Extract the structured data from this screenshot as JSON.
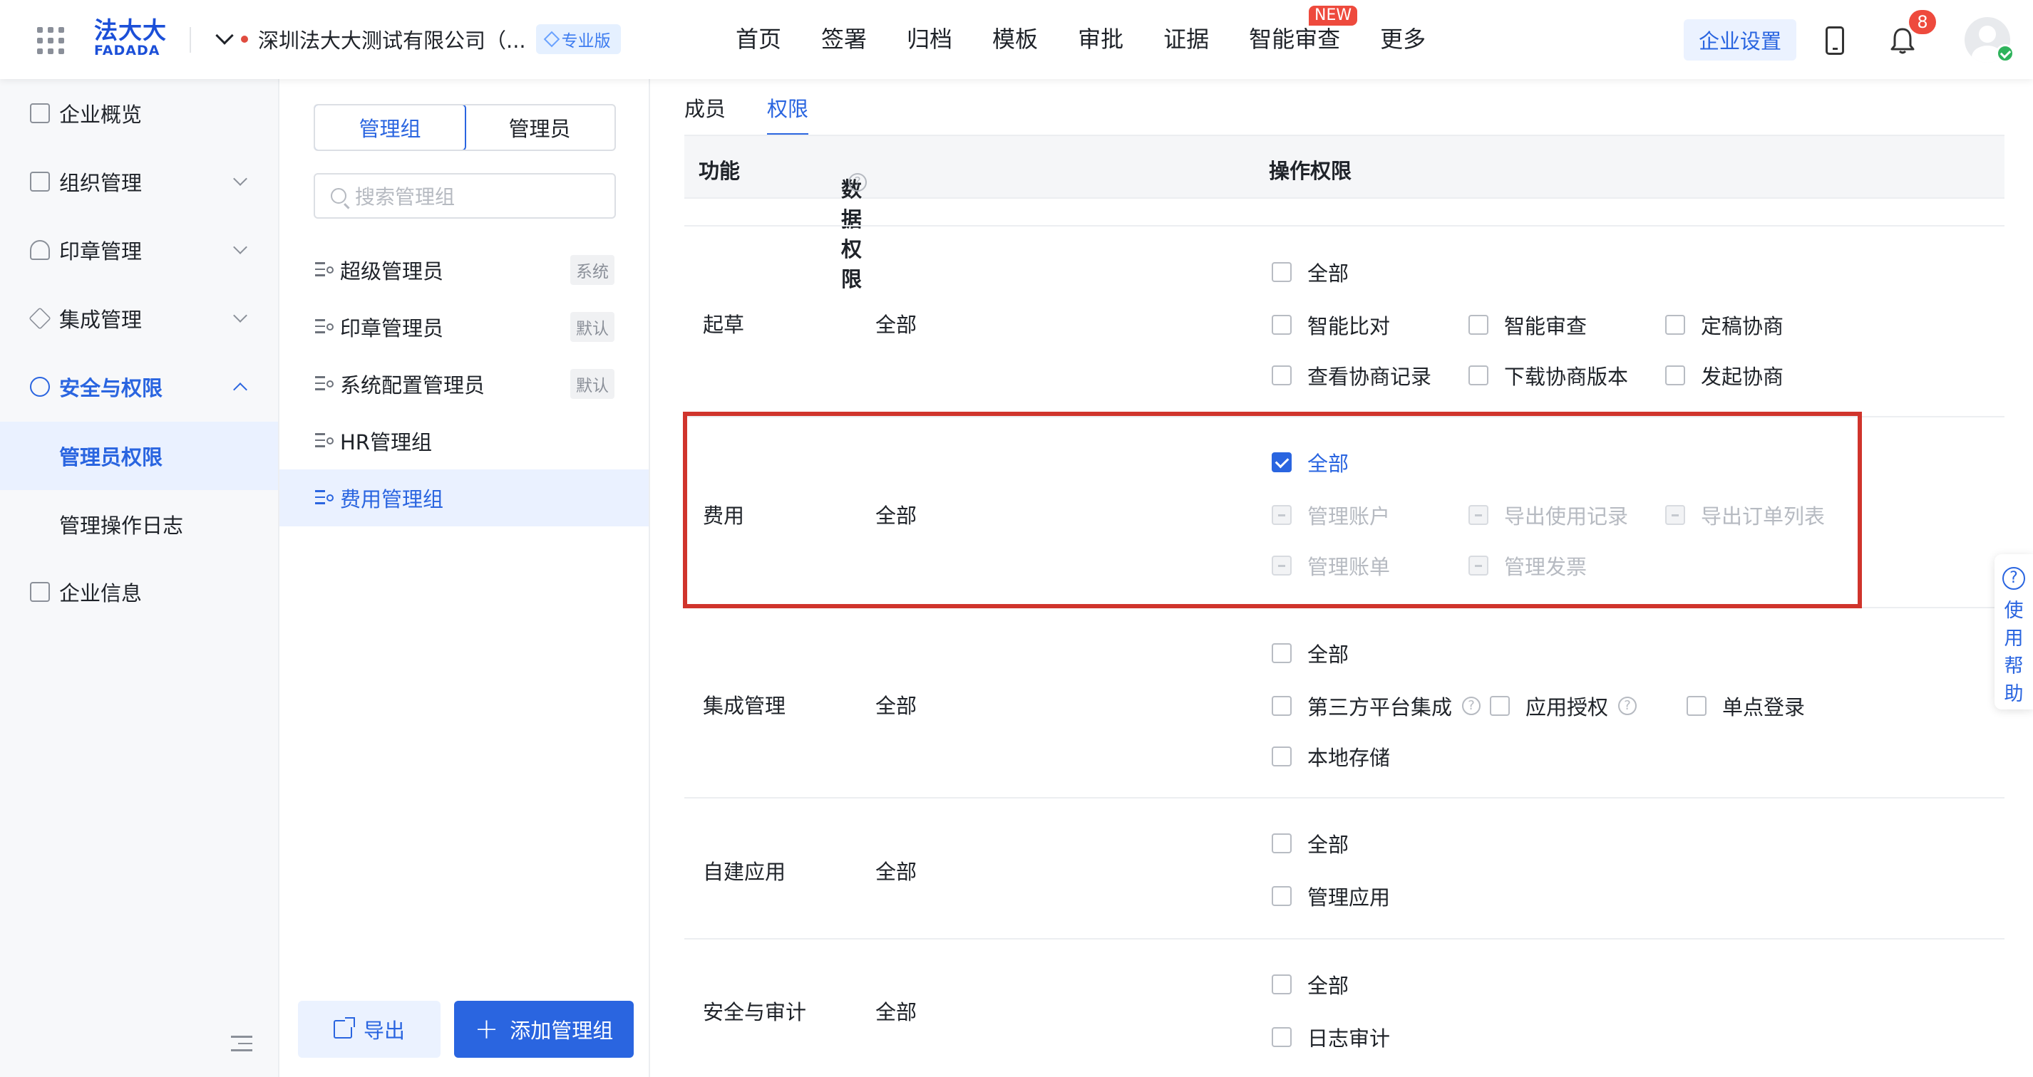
{
  "header": {
    "logo_cn": "法大大",
    "logo_en": "FADADA",
    "company_name": "深圳法大大测试有限公司（...",
    "plan_badge": "专业版",
    "nav": [
      "首页",
      "签署",
      "归档",
      "模板",
      "审批",
      "证据",
      "智能审查",
      "更多"
    ],
    "new_tag": "NEW",
    "settings_button": "企业设置",
    "notification_count": "8"
  },
  "sidebar": {
    "items": [
      {
        "label": "企业概览",
        "icon": "overview-icon"
      },
      {
        "label": "组织管理",
        "icon": "org-icon"
      },
      {
        "label": "印章管理",
        "icon": "seal-icon"
      },
      {
        "label": "集成管理",
        "icon": "layers-icon"
      },
      {
        "label": "安全与权限",
        "icon": "security-icon"
      }
    ],
    "sub_items": [
      "管理员权限",
      "管理操作日志"
    ],
    "last_item": {
      "label": "企业信息",
      "icon": "building-icon"
    }
  },
  "group_panel": {
    "segments": [
      "管理组",
      "管理员"
    ],
    "search_placeholder": "搜索管理组",
    "groups": [
      {
        "name": "超级管理员",
        "tag": "系统"
      },
      {
        "name": "印章管理员",
        "tag": "默认"
      },
      {
        "name": "系统配置管理员",
        "tag": "默认"
      },
      {
        "name": "HR管理组",
        "tag": ""
      },
      {
        "name": "费用管理组",
        "tag": ""
      }
    ],
    "export_button": "导出",
    "add_button": "添加管理组"
  },
  "main": {
    "tabs": [
      "成员",
      "权限"
    ],
    "columns": {
      "func": "功能",
      "data_perm": "数据权限",
      "op_perm": "操作权限"
    },
    "rows": [
      {
        "func": "起草",
        "data": "全部",
        "options": [
          "全部",
          "智能比对",
          "智能审查",
          "定稿协商",
          "查看协商记录",
          "下载协商版本",
          "发起协商"
        ]
      },
      {
        "func": "费用",
        "data": "全部",
        "options": [
          "全部",
          "管理账户",
          "导出使用记录",
          "导出订单列表",
          "管理账单",
          "管理发票"
        ]
      },
      {
        "func": "集成管理",
        "data": "全部",
        "options": [
          "全部",
          "第三方平台集成",
          "应用授权",
          "单点登录",
          "本地存储"
        ]
      },
      {
        "func": "自建应用",
        "data": "全部",
        "options": [
          "全部",
          "管理应用"
        ]
      },
      {
        "func": "安全与审计",
        "data": "全部",
        "options": [
          "全部",
          "日志审计"
        ]
      }
    ]
  },
  "help_float": {
    "chars": [
      "使",
      "用",
      "帮",
      "助"
    ]
  },
  "colors": {
    "accent": "#2a65e0",
    "highlight_border": "#d0342c",
    "badge_red": "#ee4a3d"
  }
}
